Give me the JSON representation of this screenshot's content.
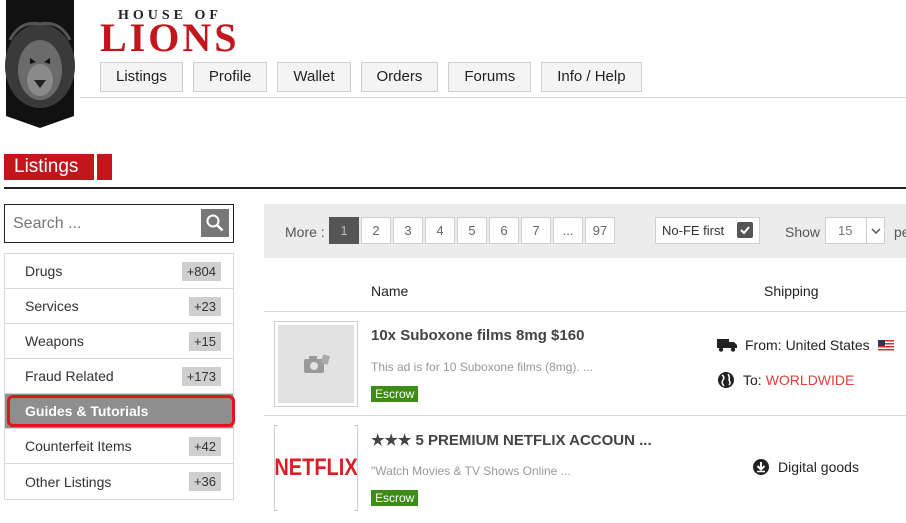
{
  "brand": {
    "top": "HOUSE OF",
    "main": "LIONS"
  },
  "nav": [
    "Listings",
    "Profile",
    "Wallet",
    "Orders",
    "Forums",
    "Info / Help"
  ],
  "section": {
    "title": "Listings"
  },
  "search": {
    "placeholder": "Search ..."
  },
  "sidebar": {
    "items": [
      {
        "label": "Drugs",
        "count": "+804"
      },
      {
        "label": "Services",
        "count": "+23"
      },
      {
        "label": "Weapons",
        "count": "+15"
      },
      {
        "label": "Fraud Related",
        "count": "+173"
      },
      {
        "label": "Guides & Tutorials",
        "count": ""
      },
      {
        "label": "Counterfeit Items",
        "count": "+42"
      },
      {
        "label": "Other Listings",
        "count": "+36"
      }
    ],
    "active_index": 4
  },
  "pager": {
    "more_label": "More :",
    "pages": [
      "1",
      "2",
      "3",
      "4",
      "5",
      "6",
      "7",
      "...",
      "97"
    ],
    "current": "1",
    "nofe_label": "No-FE first",
    "nofe_checked": true,
    "show_label": "Show",
    "show_value": "15",
    "per_label": "pe"
  },
  "table": {
    "col_name": "Name",
    "col_shipping": "Shipping",
    "listings": [
      {
        "title": "10x Suboxone films 8mg $160",
        "desc": "This ad is for 10 Suboxone films (8mg). ...",
        "badge": "Escrow",
        "ship_from_label": "From:",
        "ship_from": "United States",
        "ship_to_label": "To:",
        "ship_to": "WORLDWIDE"
      },
      {
        "title": "★★★ 5 PREMIUM NETFLIX ACCOUN ...",
        "desc": "\"Watch Movies & TV Shows Online ...",
        "badge": "Escrow",
        "thumb_text": "NETFLIX",
        "ship": "Digital goods"
      }
    ]
  },
  "colors": {
    "brand_red": "#c3161c",
    "escrow_green": "#3d8c16",
    "worldwide": "#e0403a"
  }
}
